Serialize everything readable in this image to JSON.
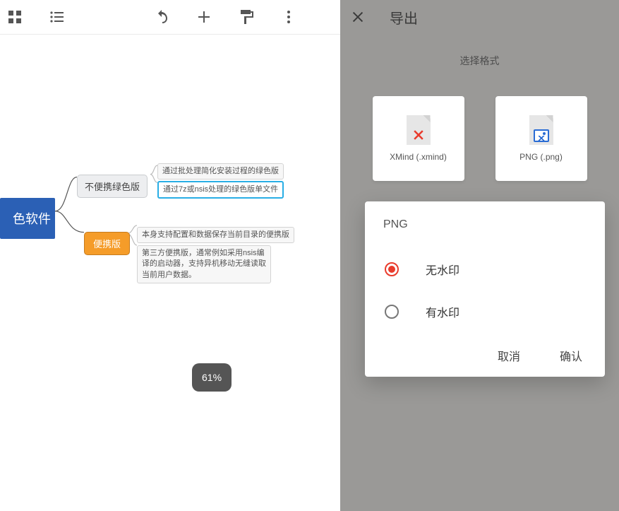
{
  "toolbar": {
    "icons": {
      "view_grid": "view-grid-icon",
      "outline_list": "outline-list-icon",
      "undo": "undo-icon",
      "add": "add-icon",
      "format": "format-paint-icon",
      "more": "more-vert-icon"
    }
  },
  "export_panel": {
    "title": "导出",
    "close_label": "close",
    "select_format_label": "选择格式",
    "formats": [
      {
        "id": "xmind",
        "caption": "XMind (.xmind)"
      },
      {
        "id": "png",
        "caption": "PNG (.png)"
      }
    ]
  },
  "dialog": {
    "title": "PNG",
    "options": [
      {
        "id": "no-watermark",
        "label": "无水印",
        "selected": true
      },
      {
        "id": "watermark",
        "label": "有水印",
        "selected": false
      }
    ],
    "cancel": "取消",
    "confirm": "确认"
  },
  "zoom": {
    "label": "61%"
  },
  "mindmap": {
    "root": "色软件",
    "mid_a": "不便携绿色版",
    "mid_b": "便携版",
    "leaf_a1": "通过批处理简化安装过程的绿色版",
    "leaf_a2": "通过7z或nsis处理的绿色版单文件",
    "leaf_b1": "本身支持配置和数据保存当前目录的便携版",
    "leaf_b2": "第三方便携版，通常例如采用nsis编译的启动器，支持异机移动无缝读取当前用户数据。"
  }
}
